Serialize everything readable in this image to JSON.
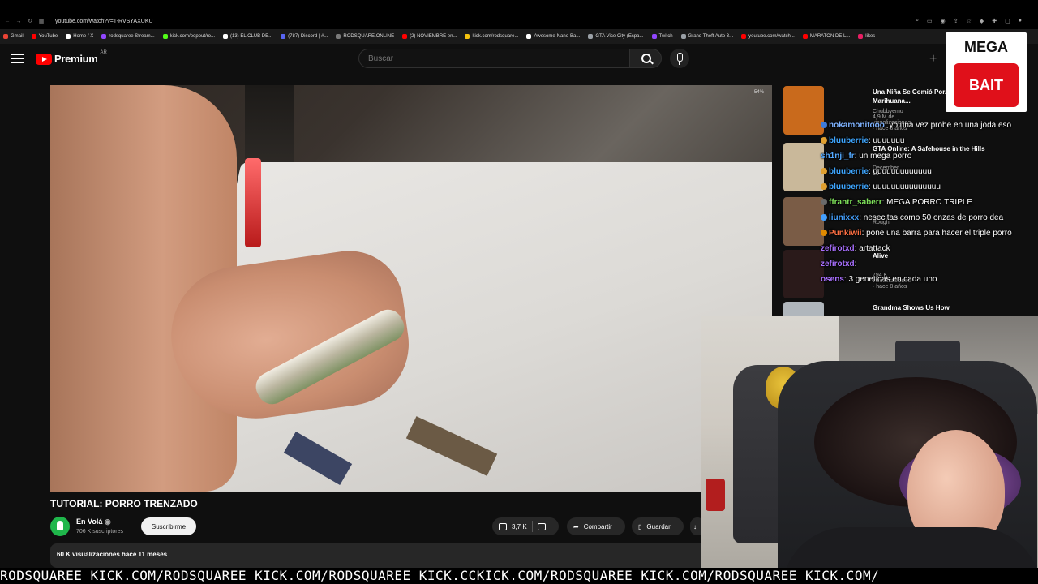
{
  "browser": {
    "url": "youtube.com/watch?v=T-RVSYAXUKU",
    "bookmarks": [
      {
        "label": "Gmail",
        "color": "#ea4335"
      },
      {
        "label": "YouTube",
        "color": "#ff0000"
      },
      {
        "label": "Home / X",
        "color": "#ffffff"
      },
      {
        "label": "rodsquaree Stream...",
        "color": "#9146ff"
      },
      {
        "label": "kick.com/popout/ro...",
        "color": "#53fc18"
      },
      {
        "label": "(13) EL CLUB DE...",
        "color": "#ffffff"
      },
      {
        "label": "(787) Discord | #...",
        "color": "#5865f2"
      },
      {
        "label": "RODSQUARE.ONLINE",
        "color": "#7a7a7a"
      },
      {
        "label": "(2) NOVIEMBRE en...",
        "color": "#ff0000"
      },
      {
        "label": "kick.com/rodsquare...",
        "color": "#f4c20d"
      },
      {
        "label": "Awesome-Nano-Ba...",
        "color": "#ffffff"
      },
      {
        "label": "GTA Vice City (Espa...",
        "color": "#9aa0a6"
      },
      {
        "label": "Twitch",
        "color": "#9146ff"
      },
      {
        "label": "Grand Theft Auto 3...",
        "color": "#9aa0a6"
      },
      {
        "label": "youtube.com/watch...",
        "color": "#ff0000"
      },
      {
        "label": "MARATON DE L...",
        "color": "#ff0000"
      },
      {
        "label": "likes",
        "color": "#e91e63"
      }
    ]
  },
  "youtube": {
    "logo_text": "Premium",
    "logo_country": "AR",
    "search_placeholder": "Buscar"
  },
  "video": {
    "corner_overlay": "54%",
    "title": "TUTORIAL: PORRO TRENZADO",
    "channel_name": "En Volá",
    "subscribers": "706 K suscriptores",
    "subscribe_label": "Suscribirme",
    "likes": "3,7 K",
    "share_label": "Compartir",
    "save_label": "Guardar",
    "views_date": "60 K visualizaciones  hace 11 meses"
  },
  "recommendations": [
    {
      "title": "Una Niña Se Comió Por... Gomitas de Marihuana...",
      "channel": "Chubbyemu",
      "meta": "4,9 M de visualizaciones · hace 3 años",
      "color": "#c96a1c"
    },
    {
      "title": "GTA Online: A Safehouse in the Hills",
      "channel": "",
      "meta": "December 10",
      "color": "#c9b89a"
    },
    {
      "title": "",
      "channel": "",
      "meta": "Rough",
      "color": "#7a5c46"
    },
    {
      "title": "Alive",
      "channel": "",
      "meta": "794 K visualizaciones · hace 8 años",
      "color": "#2a1a1a"
    },
    {
      "title": "Grandma Shows Us How",
      "channel": "",
      "meta": "",
      "color": "#b0b6bc"
    }
  ],
  "mega_bait": {
    "line1": "MEGA",
    "line2": "BAIT"
  },
  "chat": [
    {
      "user": "nokamonitooo",
      "text": ": yo una vez probe en una joda eso",
      "color": "#7fb3ff",
      "badge": "#3d7bd9"
    },
    {
      "user": "bluuberrie",
      "text": ": uuuuuuu",
      "color": "#3ea6ff",
      "badge": "#e0a030"
    },
    {
      "user": "sh1nji_fr",
      "text": ": un mega porro",
      "color": "#53a9ff",
      "badge": ""
    },
    {
      "user": "bluuberrie",
      "text": ": uuuuuuuuuuuuu",
      "color": "#3ea6ff",
      "badge": "#e0a030"
    },
    {
      "user": "bluuberrie",
      "text": ": uuuuuuuuuuuuuuu",
      "color": "#3ea6ff",
      "badge": "#e0a030"
    },
    {
      "user": "ffrantr_saberr",
      "text": ": MEGA PORRO TRIPLE",
      "color": "#7ee05a",
      "badge": "#6a6a6a"
    },
    {
      "user": "liunixxx",
      "text": ": nesecitas como 50 onzas de porro dea",
      "color": "#44a0ff",
      "badge": "#44a0ff"
    },
    {
      "user": "Punkiwii",
      "text": ": pone una barra para hacer el triple porro",
      "color": "#ff7043",
      "badge": "#e08a00"
    },
    {
      "user": "zefirotxd",
      "text": ": artattack",
      "color": "#a970ff",
      "badge": ""
    },
    {
      "user": "zefirotxd",
      "text": ":",
      "color": "#a970ff",
      "badge": ""
    },
    {
      "user": "osens",
      "text": ": 3 geneticas en cada uno",
      "color": "#a970ff",
      "badge": ""
    }
  ],
  "ticker": "RODSQUAREE KICK.COM/RODSQUAREE KICK.COM/RODSQUAREE KICK.CCKICK.COM/RODSQUAREE KICK.COM/RODSQUAREE KICK.COM/"
}
